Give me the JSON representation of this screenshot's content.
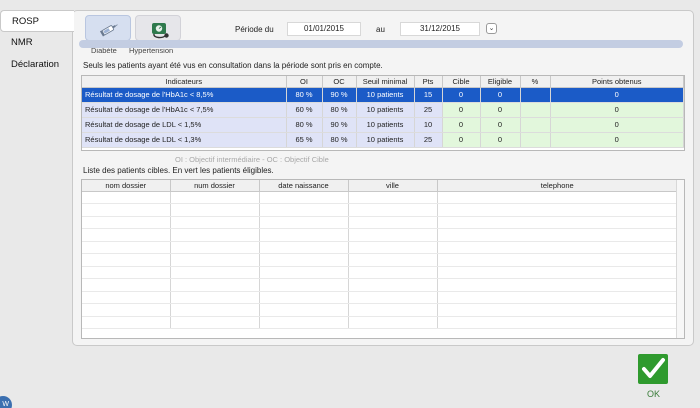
{
  "side_tabs": [
    {
      "label": "ROSP",
      "active": true
    },
    {
      "label": "NMR",
      "active": false
    },
    {
      "label": "Déclaration",
      "active": false
    }
  ],
  "icon_tabs": [
    {
      "label": "Diabète",
      "icon": "syringe-icon",
      "active": true
    },
    {
      "label": "Hypertension",
      "icon": "blood-pressure-monitor-icon",
      "active": false
    }
  ],
  "period": {
    "label": "Période du",
    "from": "01/01/2015",
    "separator": "au",
    "to": "31/12/2015",
    "dropdown_glyph": "⌄"
  },
  "info_text": "Seuls les patients ayant été vus en consultation dans la période sont pris en compte.",
  "indicators": {
    "headers": [
      "Indicateurs",
      "OI",
      "OC",
      "Seuil minimal",
      "Pts",
      "Cible",
      "Eligible",
      "%",
      "Points obtenus"
    ],
    "rows": [
      {
        "name": "Résultat de dosage de l'HbA1c < 8,5%",
        "oi": "80 %",
        "oc": "90 %",
        "seuil": "10 patients",
        "pts": "15",
        "cible": "0",
        "eligible": "0",
        "pct": "",
        "points": "0"
      },
      {
        "name": "Résultat de dosage de l'HbA1c < 7,5%",
        "oi": "60 %",
        "oc": "80 %",
        "seuil": "10 patients",
        "pts": "25",
        "cible": "0",
        "eligible": "0",
        "pct": "",
        "points": "0"
      },
      {
        "name": "Résultat de dosage de LDL < 1,5%",
        "oi": "80 %",
        "oc": "90 %",
        "seuil": "10 patients",
        "pts": "10",
        "cible": "0",
        "eligible": "0",
        "pct": "",
        "points": "0"
      },
      {
        "name": "Résultat de dosage de LDL < 1,3%",
        "oi": "65 %",
        "oc": "80 %",
        "seuil": "10 patients",
        "pts": "25",
        "cible": "0",
        "eligible": "0",
        "pct": "",
        "points": "0"
      }
    ],
    "selected_row": 0
  },
  "legend": "OI : Objectif intermédiaire - OC : Objectif Cible",
  "patients_title": "Liste des patients cibles. En vert les patients éligibles.",
  "patients": {
    "headers": [
      "nom dossier",
      "num dossier",
      "date naissance",
      "ville",
      "telephone"
    ]
  },
  "ok_label": "OK",
  "colors": {
    "selected_row": "#1b5bc7",
    "indicator_row": "#dfe3f7",
    "eligible_cells": "#e2f7dc",
    "ok_button": "#2f9a2e"
  }
}
